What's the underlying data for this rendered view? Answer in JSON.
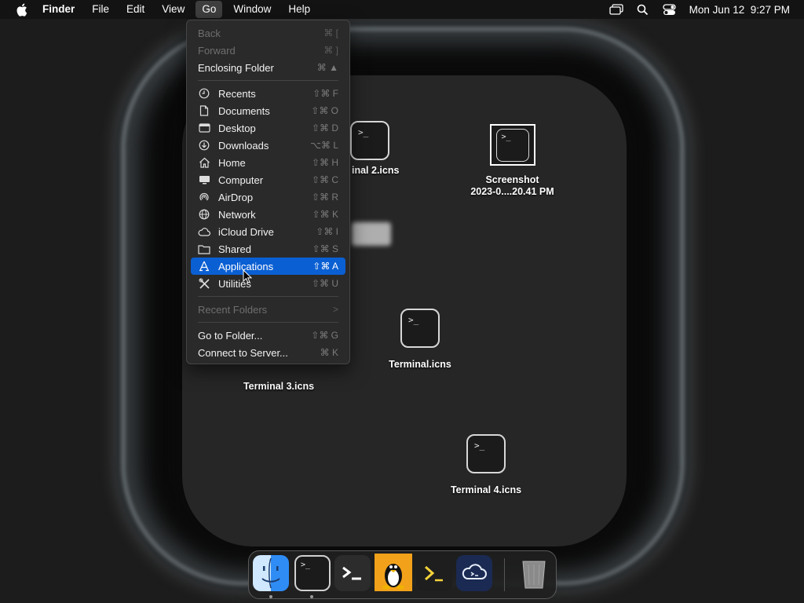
{
  "menubar": {
    "apple_icon": "apple-icon",
    "items": [
      {
        "label": "Finder",
        "bold": true
      },
      {
        "label": "File"
      },
      {
        "label": "Edit"
      },
      {
        "label": "View"
      },
      {
        "label": "Go",
        "active": true
      },
      {
        "label": "Window"
      },
      {
        "label": "Help"
      }
    ],
    "status_icons": [
      "screen-mirroring-icon",
      "search-icon",
      "control-center-icon"
    ],
    "clock": "Mon Jun 12  9:27 PM"
  },
  "go_menu": {
    "back": {
      "label": "Back",
      "shortcut": "⌘ ["
    },
    "forward": {
      "label": "Forward",
      "shortcut": "⌘ ]"
    },
    "enclosing": {
      "label": "Enclosing Folder",
      "shortcut": "⌘ ▲"
    },
    "places": [
      {
        "label": "Recents",
        "shortcut": "⇧⌘ F",
        "icon": "clock-icon"
      },
      {
        "label": "Documents",
        "shortcut": "⇧⌘ O",
        "icon": "document-icon"
      },
      {
        "label": "Desktop",
        "shortcut": "⇧⌘ D",
        "icon": "desktop-icon"
      },
      {
        "label": "Downloads",
        "shortcut": "⌥⌘ L",
        "icon": "download-icon"
      },
      {
        "label": "Home",
        "shortcut": "⇧⌘ H",
        "icon": "home-icon"
      },
      {
        "label": "Computer",
        "shortcut": "⇧⌘ C",
        "icon": "computer-icon"
      },
      {
        "label": "AirDrop",
        "shortcut": "⇧⌘ R",
        "icon": "airdrop-icon"
      },
      {
        "label": "Network",
        "shortcut": "⇧⌘ K",
        "icon": "network-icon"
      },
      {
        "label": "iCloud Drive",
        "shortcut": "⇧⌘ I",
        "icon": "cloud-icon"
      },
      {
        "label": "Shared",
        "shortcut": "⇧⌘ S",
        "icon": "shared-folder-icon"
      },
      {
        "label": "Applications",
        "shortcut": "⇧⌘ A",
        "icon": "applications-icon",
        "selected": true
      },
      {
        "label": "Utilities",
        "shortcut": "⇧⌘ U",
        "icon": "utilities-icon"
      }
    ],
    "recent_folders": {
      "label": "Recent Folders",
      "arrow": ">"
    },
    "goto": {
      "label": "Go to Folder...",
      "shortcut": "⇧⌘ G"
    },
    "connect": {
      "label": "Connect to Server...",
      "shortcut": "⌘ K"
    }
  },
  "desktop_icons": [
    {
      "label": "inal 2.icns",
      "label2": "",
      "prompt": ">_",
      "icon": "terminal-file-icon"
    },
    {
      "label": "Screenshot",
      "label2": "2023-0....20.41 PM",
      "prompt": ">_",
      "icon": "screenshot-file-icon"
    },
    {
      "label": "Terminal 3.icns",
      "label2": "",
      "prompt": ">_",
      "icon": "terminal-file-icon"
    },
    {
      "label": "Terminal.icns",
      "label2": "",
      "prompt": ">_",
      "icon": "terminal-file-icon"
    },
    {
      "label": "Terminal 4.icns",
      "label2": "",
      "prompt": ">_",
      "icon": "terminal-file-icon"
    }
  ],
  "dock": {
    "apps": [
      "finder-icon",
      "terminal-icon",
      "terminal-dark-icon",
      "linux-penguin-icon",
      "powershell-icon",
      "cloud-app-icon"
    ],
    "trash": "trash-icon"
  },
  "colors": {
    "selection": "#0a5fd3",
    "menu_bg": "#2a2a2a",
    "menubar_bg": "#131313"
  }
}
